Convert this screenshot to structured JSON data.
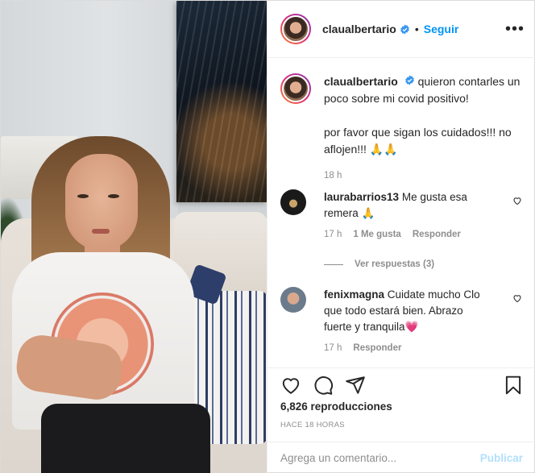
{
  "header": {
    "username": "claualbertario",
    "separator": "•",
    "follow_label": "Seguir",
    "more_label": "•••"
  },
  "caption": {
    "username": "claualbertario",
    "text_line1": "quieron contarles un poco sobre mi covid positivo!",
    "text_line2": "por favor que sigan los cuidados!!! no aflojen!!! 🙏🙏",
    "time": "18 h"
  },
  "comments": [
    {
      "username": "laurabarrios13",
      "text": "Me gusta esa remera 🙏",
      "time": "17 h",
      "likes": "1 Me gusta",
      "reply_label": "Responder",
      "view_replies": "Ver respuestas (3)"
    },
    {
      "username": "fenixmagna",
      "text": "Cuidate mucho Clo que todo estará bien. Abrazo fuerte y tranquila💗",
      "time": "17 h",
      "reply_label": "Responder"
    }
  ],
  "stats": {
    "views": "6,826 reproducciones",
    "age": "HACE 18 HORAS"
  },
  "composer": {
    "placeholder": "Agrega un comentario...",
    "publish_label": "Publicar"
  },
  "icons": {
    "verified": "verified-badge-icon",
    "like": "heart-icon",
    "comment": "comment-bubble-icon",
    "share": "paper-plane-icon",
    "save": "bookmark-icon",
    "comment_like": "small-heart-icon"
  },
  "colors": {
    "accent": "#0095f6",
    "muted": "#8e8e8e",
    "publish_disabled": "#b2dffc"
  }
}
